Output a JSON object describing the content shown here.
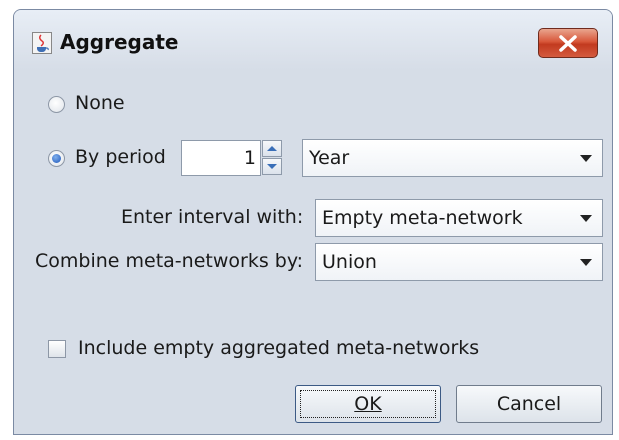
{
  "window": {
    "title": "Aggregate",
    "icon": "java-cup-icon",
    "close_icon": "close-icon"
  },
  "options": {
    "none_label": "None",
    "by_period_label": "By period",
    "selected": "by_period",
    "period_value": "1",
    "period_unit": "Year"
  },
  "interval": {
    "label": "Enter interval with:",
    "value": "Empty meta-network"
  },
  "combine": {
    "label": "Combine meta-networks by:",
    "value": "Union"
  },
  "include_empty": {
    "label": "Include empty aggregated meta-networks",
    "checked": false
  },
  "buttons": {
    "ok": "OK",
    "cancel": "Cancel"
  },
  "colors": {
    "close_button": "#d8573a",
    "dialog_bg": "#d6dde7",
    "radio_selected": "#1f56b9"
  }
}
